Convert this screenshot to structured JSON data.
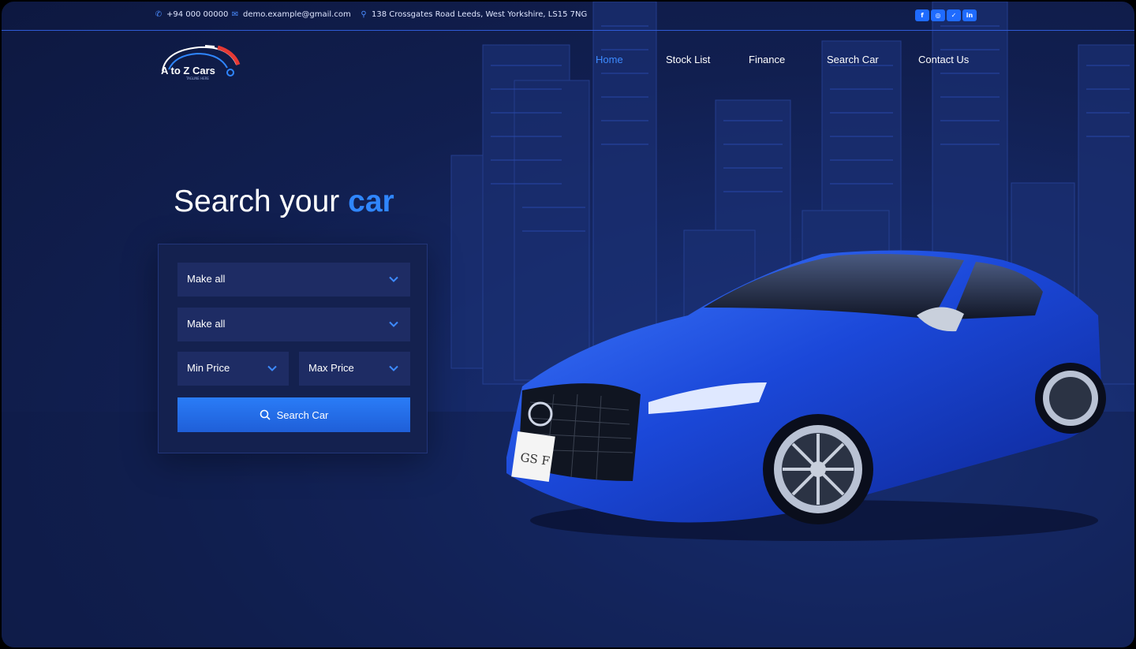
{
  "topbar": {
    "phone": "+94 000 00000",
    "email": "demo.example@gmail.com",
    "address": "138 Crossgates Road Leeds, West Yorkshire, LS15 7NG",
    "social": [
      {
        "icon": "facebook-icon",
        "glyph": "f"
      },
      {
        "icon": "instagram-icon",
        "glyph": "◎"
      },
      {
        "icon": "twitter-icon",
        "glyph": "✓"
      },
      {
        "icon": "linkedin-icon",
        "glyph": "in"
      }
    ]
  },
  "brand": {
    "name": "A to Z Cars",
    "tagline": "TAGLINE HERE"
  },
  "nav": [
    {
      "label": "Home",
      "active": true
    },
    {
      "label": "Stock List",
      "active": false
    },
    {
      "label": "Finance",
      "active": false
    },
    {
      "label": "Search Car",
      "active": false
    },
    {
      "label": "Contact Us",
      "active": false
    }
  ],
  "hero": {
    "title_prefix": "Search your",
    "title_accent": "car"
  },
  "search": {
    "make": "Make all",
    "model": "Make all",
    "min_price": "Min Price",
    "max_price": "Max Price",
    "button": "Search Car"
  },
  "car": {
    "plate": "GS F"
  },
  "colors": {
    "background": "#111f50",
    "accent": "#2f86ff",
    "panel": "#14214f",
    "field": "#1e2c64",
    "button": "#1f6bff"
  }
}
